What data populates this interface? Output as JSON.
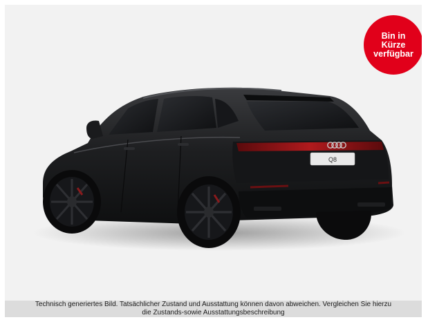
{
  "vehicle": {
    "model_plate": "Q8",
    "image_description_icon": "car-rear-three-quarter-image",
    "paint_color": "#1c1d1f"
  },
  "badge": {
    "line1": "Bin in",
    "line2": "Kürze",
    "line3": "verfügbar",
    "color": "#e1001a"
  },
  "disclaimer": {
    "line1": "Technisch generiertes Bild. Tatsächlicher Zustand und Ausstattung können davon abweichen. Vergleichen Sie hierzu",
    "line2": "die Zustands-sowie Ausstattungsbeschreibung"
  }
}
